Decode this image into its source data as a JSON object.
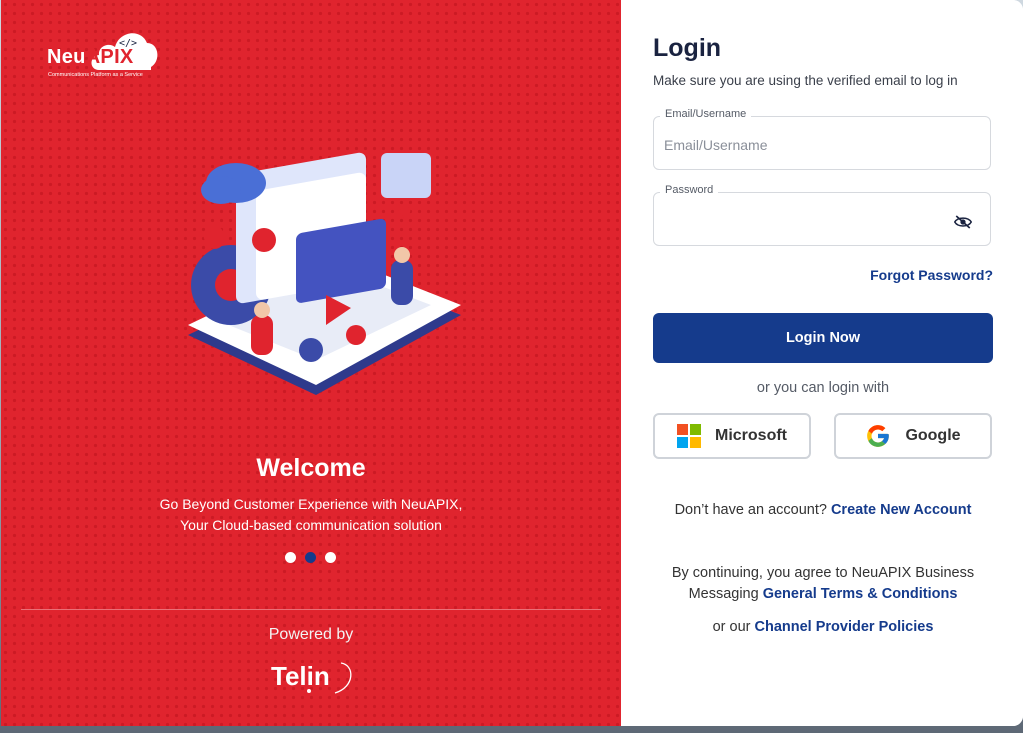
{
  "branding": {
    "logo_prefix": "Neu",
    "logo_highlight": "APIX",
    "logo_code_glyph": "</>",
    "logo_tagline": "Communications Platform as a Service",
    "brand_red": "#e0242e",
    "brand_blue": "#153b8c"
  },
  "hero": {
    "title": "Welcome",
    "line1": "Go Beyond Customer Experience with NeuAPIX,",
    "line2": "Your Cloud-based communication solution",
    "carousel": {
      "total": 3,
      "active": 2
    },
    "powered_by": "Powered by",
    "partner_logo": "Telin"
  },
  "login": {
    "title": "Login",
    "subtitle": "Make sure you are using the verified email to log in",
    "email_label": "Email/Username",
    "email_placeholder": "Email/Username",
    "email_value": "",
    "password_label": "Password",
    "password_value": "",
    "password_toggle_icon": "eye-off-icon",
    "forgot_label": "Forgot Password?",
    "submit_label": "Login Now",
    "alt_login_text": "or you can login with",
    "sso": [
      {
        "label": "Microsoft",
        "icon": "microsoft-icon"
      },
      {
        "label": "Google",
        "icon": "google-icon"
      }
    ],
    "signup_prompt": "Don’t have an account?",
    "signup_link": "Create New Account",
    "terms_prefix": "By continuing, you agree to NeuAPIX Business Messaging",
    "terms_link": "General Terms & Conditions",
    "policy_prefix": "or our",
    "policy_link": "Channel Provider Policies"
  }
}
